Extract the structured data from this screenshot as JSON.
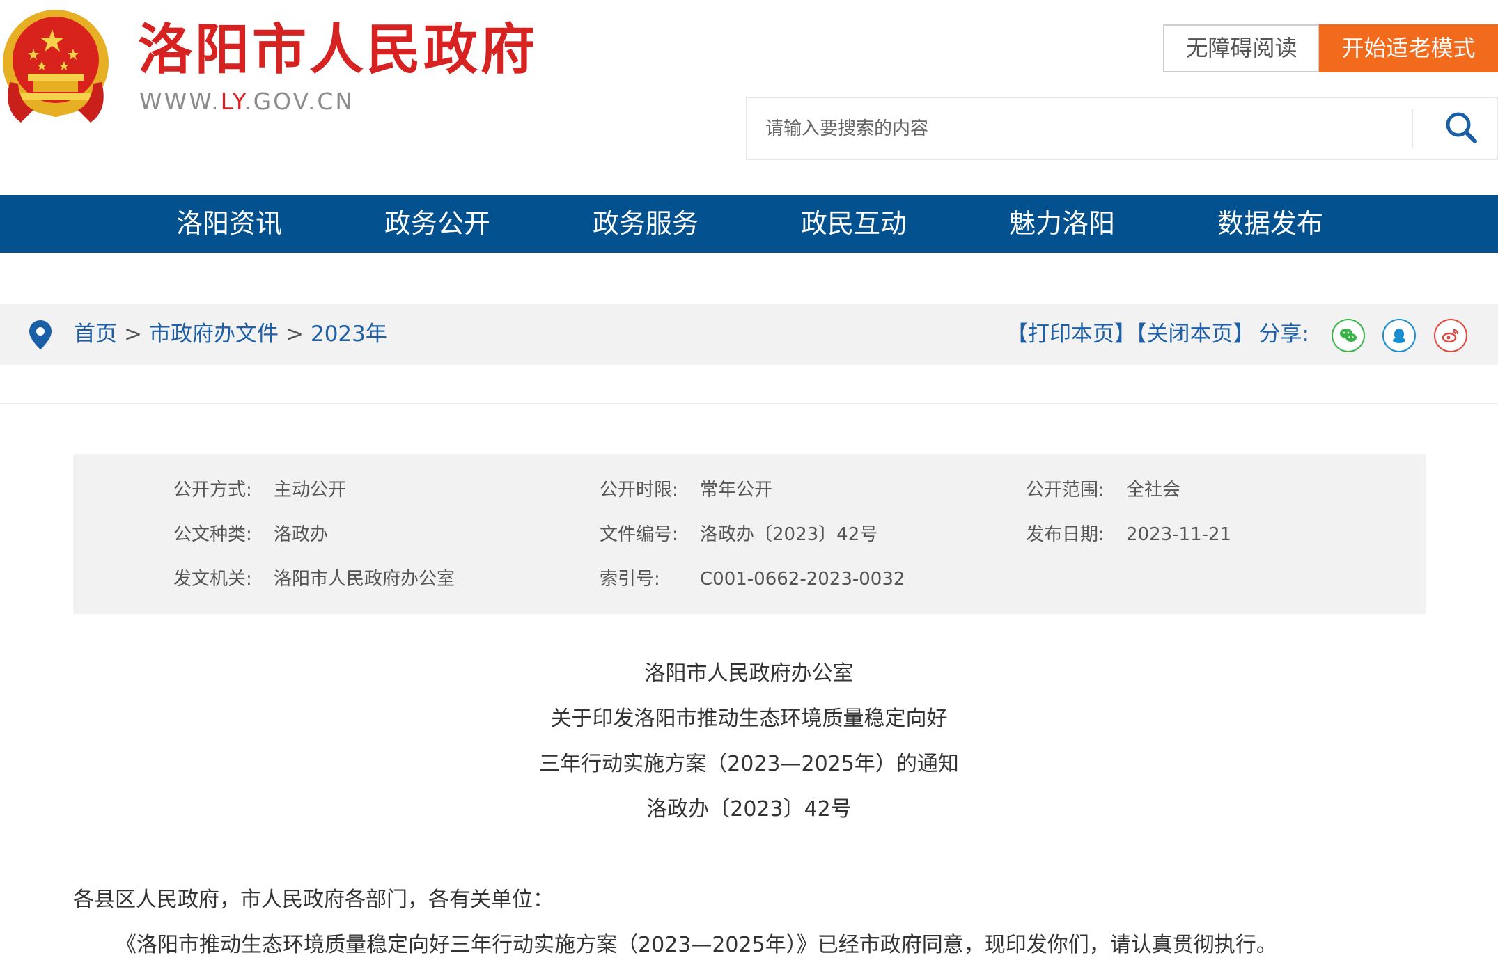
{
  "header": {
    "site_title": "洛阳市人民政府",
    "url_prefix": "WWW.",
    "url_highlight": "LY",
    "url_suffix": ".GOV.CN",
    "accessible_reading": "无障碍阅读",
    "elder_mode": "开始适老模式",
    "search_placeholder": "请输入要搜索的内容"
  },
  "nav": [
    {
      "label": "洛阳资讯"
    },
    {
      "label": "政务公开"
    },
    {
      "label": "政务服务"
    },
    {
      "label": "政民互动"
    },
    {
      "label": "魅力洛阳"
    },
    {
      "label": "数据发布"
    }
  ],
  "breadcrumb": {
    "items": [
      "首页",
      "市政府办文件",
      "2023年"
    ],
    "separator": ">",
    "print": "【打印本页】",
    "close": "【关闭本页】",
    "share": "分享:"
  },
  "meta": {
    "disclosure_method_label": "公开方式:",
    "disclosure_method": "主动公开",
    "disclosure_period_label": "公开时限:",
    "disclosure_period": "常年公开",
    "disclosure_scope_label": "公开范围:",
    "disclosure_scope": "全社会",
    "doc_type_label": "公文种类:",
    "doc_type": "洛政办",
    "doc_number_label": "文件编号:",
    "doc_number": "洛政办〔2023〕42号",
    "publish_date_label": "发布日期:",
    "publish_date": "2023-11-21",
    "issuer_label": "发文机关:",
    "issuer": "洛阳市人民政府办公室",
    "index_label": "索引号:",
    "index": "C001-0662-2023-0032"
  },
  "document": {
    "title_lines": [
      "洛阳市人民政府办公室",
      "关于印发洛阳市推动生态环境质量稳定向好",
      "三年行动实施方案（2023—2025年）的通知",
      "洛政办〔2023〕42号"
    ],
    "salutation": "各县区人民政府，市人民政府各部门，各有关单位：",
    "paragraph_1": "《洛阳市推动生态环境质量稳定向好三年行动实施方案（2023—2025年）》已经市政府同意，现印发你们，请认真贯彻执行。"
  },
  "colors": {
    "nav_bg": "#04518f",
    "title_red": "#d62321",
    "elder_orange": "#f26a1b",
    "link_blue": "#1e5fa5"
  }
}
